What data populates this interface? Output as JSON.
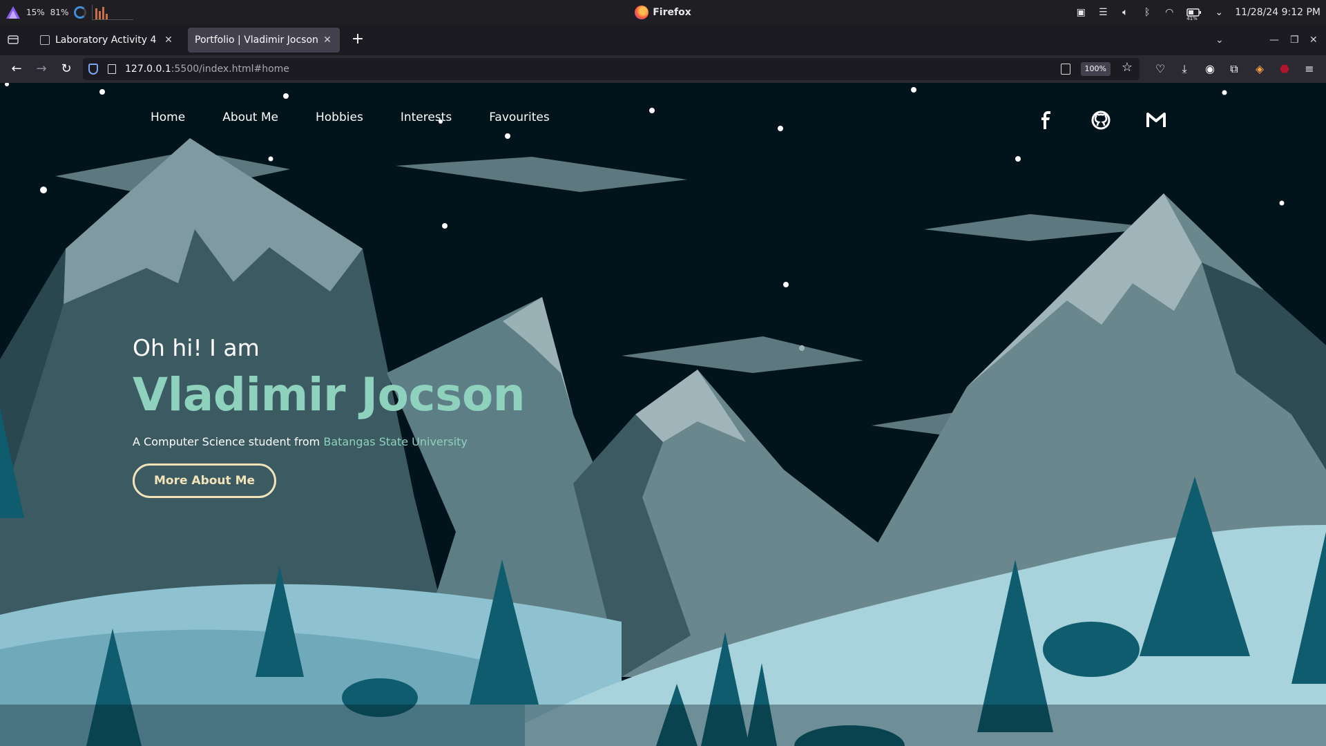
{
  "system_bar": {
    "cpu_percent": "15%",
    "mem_percent": "81%",
    "app_title": "Firefox",
    "battery_percent": "41%",
    "datetime": "11/28/24 9:12 PM"
  },
  "tabs": [
    {
      "label": "Laboratory Activity 4",
      "active": false
    },
    {
      "label": "Portfolio | Vladimir Jocson",
      "active": true
    }
  ],
  "address_bar": {
    "url_host": "127.0.0.1",
    "url_rest": ":5500/index.html#home",
    "zoom": "100%"
  },
  "site": {
    "nav": [
      "Home",
      "About Me",
      "Hobbies",
      "Interests",
      "Favourites"
    ],
    "socials": [
      "facebook-icon",
      "github-icon",
      "gmail-icon"
    ],
    "hero": {
      "greeting": "Oh hi! I am",
      "name": "Vladimir Jocson",
      "tagline_prefix": "A Computer Science student from ",
      "tagline_highlight": "Batangas State University",
      "cta_label": "More About Me"
    }
  },
  "colors": {
    "sky": "#02141b",
    "accent": "#8ed1bd",
    "cta_border": "#f2e3b8",
    "mountain_light": "#7d9ca3",
    "mountain_dark": "#3b5a62",
    "snow": "#8fc2d0",
    "tree": "#0e5c6e"
  }
}
